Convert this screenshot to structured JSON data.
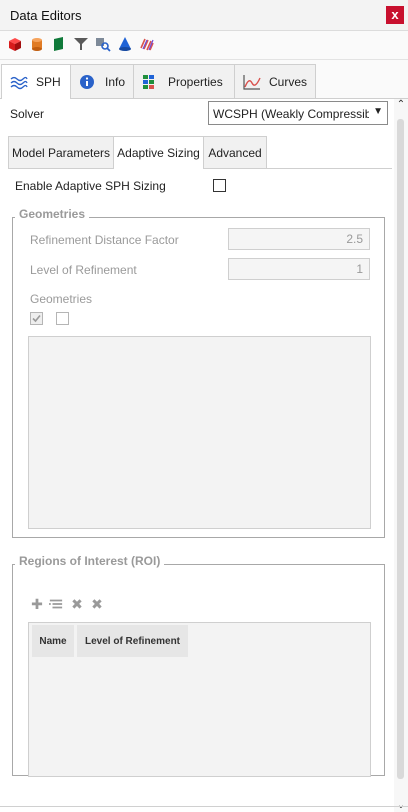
{
  "window": {
    "title": "Data Editors",
    "close_label": "x"
  },
  "toolbar": {
    "icons": [
      "cube-icon",
      "cylinder-icon",
      "flag-icon",
      "filter-icon",
      "search-icon",
      "cone-icon",
      "stripes-icon"
    ]
  },
  "tabs": [
    {
      "label": "SPH",
      "icon": "waves-icon",
      "active": true
    },
    {
      "label": "Info",
      "icon": "info-icon",
      "active": false
    },
    {
      "label": "Properties",
      "icon": "properties-icon",
      "active": false
    },
    {
      "label": "Curves",
      "icon": "curves-icon",
      "active": false
    }
  ],
  "solver": {
    "label": "Solver",
    "value": "WCSPH (Weakly Compressible SP"
  },
  "subtabs": [
    {
      "label": "Model Parameters",
      "active": false
    },
    {
      "label": "Adaptive Sizing",
      "active": true
    },
    {
      "label": "Advanced",
      "active": false
    }
  ],
  "adaptive": {
    "enable_label": "Enable Adaptive SPH Sizing",
    "enabled": false
  },
  "geometries_group": {
    "title": "Geometries",
    "refinement_distance_factor_label": "Refinement Distance Factor",
    "refinement_distance_factor_value": "2.5",
    "level_of_refinement_label": "Level of Refinement",
    "level_of_refinement_value": "1",
    "geometries_label": "Geometries"
  },
  "roi_group": {
    "title": "Regions of Interest (ROI)",
    "toolbar_icons": [
      "add-icon",
      "list-edit-icon",
      "delete-icon",
      "delete-all-icon"
    ],
    "columns": [
      "Name",
      "Level of Refinement"
    ],
    "rows": []
  },
  "colors": {
    "close": "#c8102e",
    "accent": "#2a62c9"
  }
}
